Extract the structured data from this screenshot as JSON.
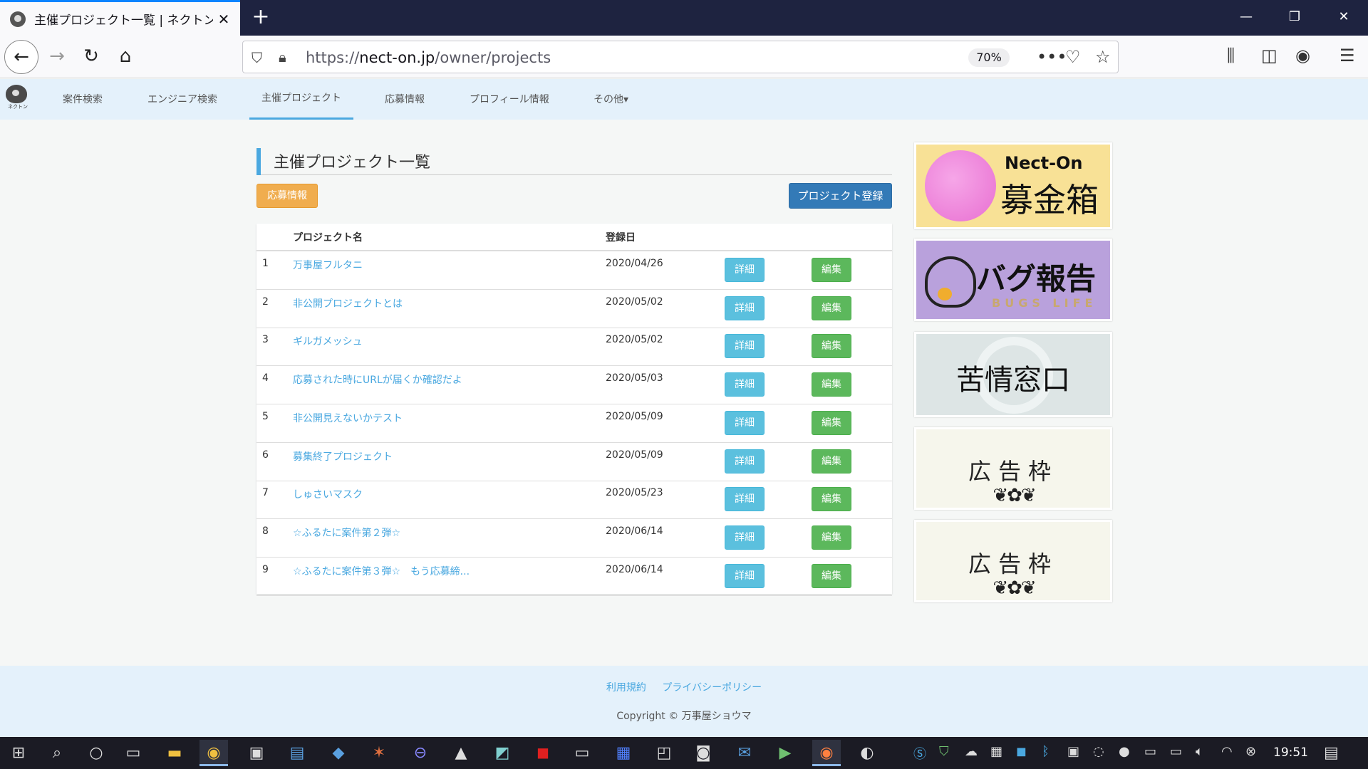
{
  "browser": {
    "tab_title": "主催プロジェクト一覧 | ネクトン",
    "tab_close": "✕",
    "new_tab": "+",
    "url_prefix": "https://",
    "url_host": "nect-on.jp",
    "url_path": "/owner/projects",
    "zoom": "70%",
    "window_controls": {
      "minimize": "—",
      "restore": "❐",
      "close": "✕"
    },
    "icons": [
      "back-arrow-icon",
      "forward-arrow-icon",
      "reload-icon",
      "home-icon",
      "shield-icon",
      "lock-icon",
      "more-icon",
      "pocket-icon",
      "star-icon",
      "library-icon",
      "sidebar-icon",
      "account-icon",
      "menu-icon"
    ]
  },
  "site": {
    "logo_text": "ネクトン",
    "nav": [
      {
        "label": "案件検索"
      },
      {
        "label": "エンジニア検索"
      },
      {
        "label": "主催プロジェクト"
      },
      {
        "label": "応募情報"
      },
      {
        "label": "プロフィール情報"
      },
      {
        "label": "その他▾"
      }
    ],
    "active_nav": "主催プロジェクト"
  },
  "main": {
    "heading": "主催プロジェクト一覧",
    "applications_button": "応募情報",
    "register_button": "プロジェクト登録",
    "table": {
      "columns": [
        "プロジェクト名",
        "登録日"
      ],
      "detail_label": "詳細",
      "edit_label": "編集",
      "rows": [
        {
          "num": "1",
          "name": "万事屋フルタニ",
          "date": "2020/04/26"
        },
        {
          "num": "2",
          "name": "非公開プロジェクトとは",
          "date": "2020/05/02"
        },
        {
          "num": "3",
          "name": "ギルガメッシュ",
          "date": "2020/05/02"
        },
        {
          "num": "4",
          "name": "応募された時にURLが届くか確認だよ",
          "date": "2020/05/03"
        },
        {
          "num": "5",
          "name": "非公開見えないかテスト",
          "date": "2020/05/09"
        },
        {
          "num": "6",
          "name": "募集終了プロジェクト",
          "date": "2020/05/09"
        },
        {
          "num": "7",
          "name": "しゅさいマスク",
          "date": "2020/05/23"
        },
        {
          "num": "8",
          "name": "☆ふるたに案件第２弾☆",
          "date": "2020/06/14"
        },
        {
          "num": "9",
          "name": "☆ふるたに案件第３弾☆　もう応募締...",
          "date": "2020/06/14"
        }
      ]
    }
  },
  "banners": {
    "donation_brand": "Nect-On",
    "donation_title": "募金箱",
    "bug_title": "バグ報告",
    "bug_sub": "BUGS LIFE",
    "complaint_title": "苦情窓口",
    "ad_label": "広告枠",
    "ad_ornament": "❦✿❦"
  },
  "footer": {
    "terms": "利用規約",
    "privacy": "プライバシーポリシー",
    "copyright": "Copyright © 万事屋ショウマ"
  },
  "taskbar": {
    "clock": "19:51"
  }
}
